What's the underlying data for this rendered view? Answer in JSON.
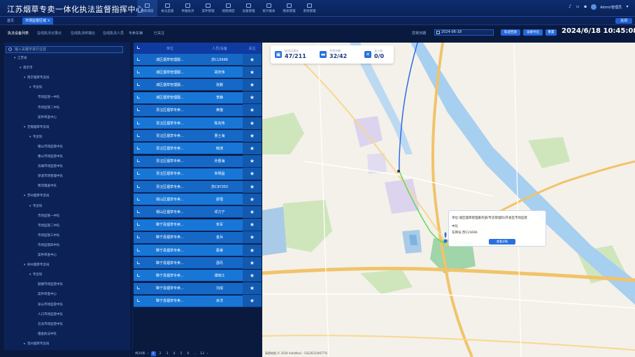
{
  "app": {
    "title": "江苏烟草专卖一体化执法监督指挥中心"
  },
  "topnav": [
    {
      "label": "指挥调度",
      "active": true
    },
    {
      "label": "执法监督",
      "active": false
    },
    {
      "label": "举报投诉",
      "active": false
    },
    {
      "label": "案件管理",
      "active": false
    },
    {
      "label": "视频调度",
      "active": false
    },
    {
      "label": "设备管理",
      "active": false
    },
    {
      "label": "统计报表",
      "active": false
    },
    {
      "label": "图表管理",
      "active": false
    },
    {
      "label": "系统管理",
      "active": false
    }
  ],
  "header_right": {
    "user_label": "Admin管理员"
  },
  "tabbar": {
    "home": "首页",
    "current": "市场监督区域",
    "more": "关闭"
  },
  "subtabs": [
    {
      "label": "执法设备列表",
      "active": true
    },
    {
      "label": "在线执法记录仪",
      "active": false
    },
    {
      "label": "在线执法终端仪",
      "active": false
    },
    {
      "label": "在线执法人员",
      "active": false
    },
    {
      "label": "专卖车辆",
      "active": false
    },
    {
      "label": "已关注",
      "active": false
    }
  ],
  "date_filter": {
    "label": "异常日期",
    "value": "2024-06-18"
  },
  "buttons": {
    "query": "轨迹回放",
    "export": "设备导出",
    "reset": "重置"
  },
  "clock": "2024/6/18 10:45:08",
  "tree": {
    "search_placeholder": "输入关键字进行过滤",
    "nodes": [
      {
        "label": "江苏省",
        "level": 0,
        "expanded": true
      },
      {
        "label": "南京市",
        "level": 1,
        "expanded": true
      },
      {
        "label": "南京烟草专卖局",
        "level": 2,
        "expanded": true
      },
      {
        "label": "专卖科",
        "level": 3,
        "expanded": true
      },
      {
        "label": "市场监管一中队",
        "level": 4
      },
      {
        "label": "市场监管二中队",
        "level": 4
      },
      {
        "label": "案件审查中心",
        "level": 4
      },
      {
        "label": "无锡烟草专卖局",
        "level": 2,
        "expanded": true
      },
      {
        "label": "专卖科",
        "level": 3,
        "expanded": true
      },
      {
        "label": "锡山市场监管中队",
        "level": 4
      },
      {
        "label": "惠山市场监管中队",
        "level": 4
      },
      {
        "label": "滨湖市场监管中队",
        "level": 4
      },
      {
        "label": "梁溪市场管理中队",
        "level": 4
      },
      {
        "label": "物流稽查中队",
        "level": 4
      },
      {
        "label": "苏州烟草专卖局",
        "level": 2,
        "expanded": true
      },
      {
        "label": "专卖科",
        "level": 3,
        "expanded": true
      },
      {
        "label": "市场监管一中队",
        "level": 4
      },
      {
        "label": "市场监管二中队",
        "level": 4
      },
      {
        "label": "市场监管三中队",
        "level": 4
      },
      {
        "label": "市场监管四中队",
        "level": 4
      },
      {
        "label": "案件审查中心",
        "level": 4
      },
      {
        "label": "徐州烟草专卖局",
        "level": 2,
        "expanded": true
      },
      {
        "label": "专卖科",
        "level": 3,
        "expanded": true
      },
      {
        "label": "鼓楼市场监管中队",
        "level": 4
      },
      {
        "label": "案件审查中心",
        "level": 4
      },
      {
        "label": "泉山市场监管中队",
        "level": 4
      },
      {
        "label": "人口市场监管中队",
        "level": 4
      },
      {
        "label": "云龙市场监管中队",
        "level": 4
      },
      {
        "label": "稽查执法中队",
        "level": 4
      },
      {
        "label": "常州烟草专卖局",
        "level": 2,
        "expanded": false
      }
    ]
  },
  "list": {
    "headers": {
      "unit": "单位",
      "person": "人员/设备",
      "follow": "关注"
    },
    "rows": [
      {
        "unit": "城区烟草管理服...",
        "person": "苏CL5696"
      },
      {
        "unit": "城区烟草管理服...",
        "person": "郑庆伟"
      },
      {
        "unit": "城区烟草管理服...",
        "person": "张鹏"
      },
      {
        "unit": "城区烟草管理服...",
        "person": "李静"
      },
      {
        "unit": "贾汪区烟草专卖...",
        "person": "黄蓓"
      },
      {
        "unit": "贾汪区烟草专卖...",
        "person": "陈向伟"
      },
      {
        "unit": "贾汪区烟草专卖...",
        "person": "曹士海"
      },
      {
        "unit": "贾汪区烟草专卖...",
        "person": "韩涛"
      },
      {
        "unit": "贾汪区烟草专卖...",
        "person": "孙晋海"
      },
      {
        "unit": "贾汪区烟草专卖...",
        "person": "朱明昌"
      },
      {
        "unit": "贾汪区烟草专卖...",
        "person": "苏C9Y355"
      },
      {
        "unit": "铜山区烟草专卖...",
        "person": "廖瑾"
      },
      {
        "unit": "铜山区烟草专卖...",
        "person": "邓力宁"
      },
      {
        "unit": "睢宁县烟草专卖...",
        "person": "朱军"
      },
      {
        "unit": "睢宁县烟草专卖...",
        "person": "金兵"
      },
      {
        "unit": "睢宁县烟草专卖...",
        "person": "蔡睿"
      },
      {
        "unit": "睢宁县烟草专卖...",
        "person": "邵丹"
      },
      {
        "unit": "睢宁县烟草专卖...",
        "person": "谭晓江"
      },
      {
        "unit": "睢宁县烟草专卖...",
        "person": "刘成"
      },
      {
        "unit": "睢宁县烟草专卖...",
        "person": "余洋"
      }
    ],
    "follow_icon": "star-icon",
    "pager": {
      "total": "共20条",
      "pages": [
        "1",
        "2",
        "3",
        "4",
        "5",
        "6",
        "...",
        "13"
      ],
      "active": "1"
    }
  },
  "map": {
    "stats": [
      {
        "label": "执法记录仪",
        "value": "47/211",
        "icon": "recorder-icon"
      },
      {
        "label": "专卖车辆",
        "value": "32/42",
        "icon": "car-icon"
      },
      {
        "label": "无人机",
        "value": "0/0",
        "icon": "drone-icon"
      }
    ],
    "popup": {
      "line1": "单位:城区烟草管理服务部/专卖管理科/开发区市场监管",
      "line2": "中队",
      "line3": "车牌号:苏CL5696",
      "button": "查看详情"
    },
    "attribution": "高德地图  © 2024 AutoNavi - GS(2023)4677号"
  }
}
